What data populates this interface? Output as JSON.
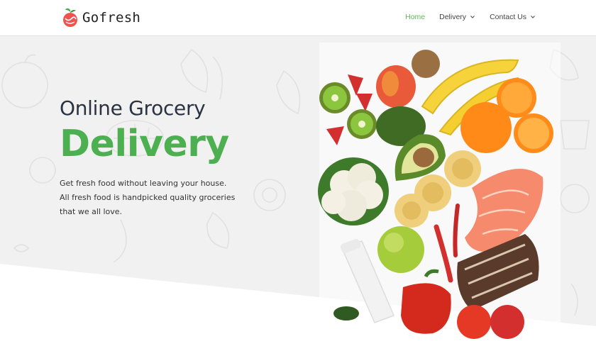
{
  "brand": {
    "name": "Gofresh",
    "accent": "#4caf50"
  },
  "nav": {
    "items": [
      {
        "label": "Home",
        "active": true,
        "dropdown": false
      },
      {
        "label": "Delivery",
        "active": false,
        "dropdown": true
      },
      {
        "label": "Contact Us",
        "active": false,
        "dropdown": true
      }
    ]
  },
  "hero": {
    "subtitle": "Online Grocery",
    "title": "Delivery",
    "description": "Get fresh food without leaving your house. All fresh food is handpicked quality groceries that we all love."
  }
}
